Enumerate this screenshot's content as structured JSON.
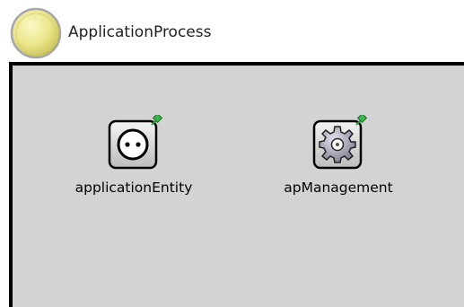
{
  "module": {
    "title": "ApplicationProcess",
    "icon": "yellow-circle-icon"
  },
  "submodules": [
    {
      "label": "applicationEntity",
      "icon": "socket-icon",
      "badge": "pin-icon"
    },
    {
      "label": "apManagement",
      "icon": "gear-icon",
      "badge": "pin-icon"
    }
  ],
  "colors": {
    "canvas_background": "#d3d3d3",
    "border": "#000000",
    "module_icon": "#e8e48a",
    "pin": "#2e9a3a"
  }
}
